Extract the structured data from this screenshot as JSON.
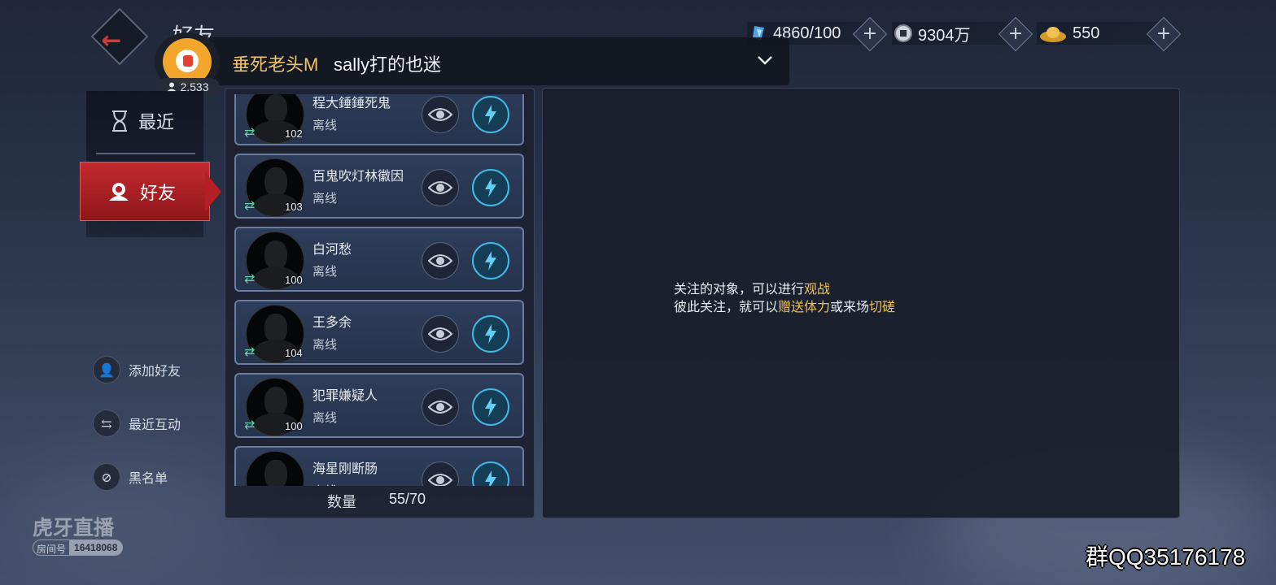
{
  "screen": {
    "title": "好友"
  },
  "currencies": [
    {
      "icon": "stamina-crystal-icon",
      "value": "4860/100"
    },
    {
      "icon": "coin-icon",
      "value": "9304万"
    },
    {
      "icon": "gold-ingot-icon",
      "value": "550"
    }
  ],
  "stream": {
    "viewer_count": "2,533",
    "username": "垂死老头M",
    "message": "sally打的也迷"
  },
  "nav": {
    "recent": "最近",
    "friends": "好友"
  },
  "side_links": {
    "add_friend": "添加好友",
    "recent_interaction": "最近互动",
    "blacklist": "黑名单"
  },
  "friends": [
    {
      "name": "程大錘錘死鬼",
      "status": "离线",
      "level": "102"
    },
    {
      "name": "百鬼吹灯林徽因",
      "status": "离线",
      "level": "103"
    },
    {
      "name": "白河愁",
      "status": "离线",
      "level": "100"
    },
    {
      "name": "王多余",
      "status": "离线",
      "level": "104"
    },
    {
      "name": "犯罪嫌疑人",
      "status": "离线",
      "level": "100"
    },
    {
      "name": "海星刚断肠",
      "status": "离线",
      "level": ""
    }
  ],
  "list_footer": {
    "label": "数量",
    "value": "55/70"
  },
  "hint": {
    "line1_prefix": "关注的对象，可以进行",
    "line1_highlight": "观战",
    "line2_prefix": "彼此关注，就可以",
    "line2_highlight1": "赠送体力",
    "line2_mid": "或来场",
    "line2_highlight2": "切磋"
  },
  "watermark": {
    "logo": "虎牙直播",
    "room_label": "房间号",
    "room_number": "16418068",
    "qq_group": "群QQ35176178"
  },
  "colors": {
    "accent_red": "#c42a2e",
    "highlight_gold": "#f2c04e",
    "gift_blue": "#42b9e6"
  }
}
